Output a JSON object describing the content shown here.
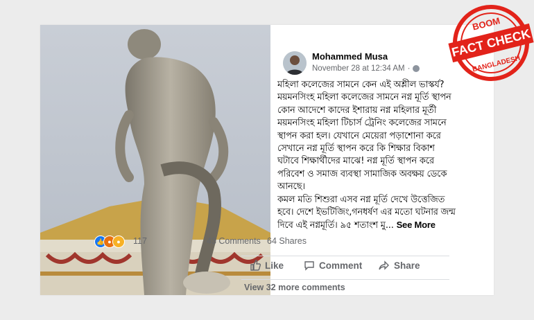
{
  "post": {
    "author": "Mohammed Musa",
    "timestamp": "November 28 at 12:34 AM",
    "separator": "·",
    "lines": [
      "মহিলা কলেজের সামনে কেন এই অশ্লীল ভাস্কর্য?",
      "ময়মনসিংহ মহিলা কলেজের সামনে নগ্ন মূর্তি স্থাপন",
      "কোন আদেশে কাদের ইশারায় নগ্ন মহিলার মূর্তী",
      "ময়মনসিংহ মহিলা টিচার্স ট্রেনিং কলেজের সামনে",
      "স্থাপন করা হল। যেখানে মেয়েরা পড়াশোনা করে",
      "সেখানে নগ্ন মূর্তি স্থাপন করে কি শিক্ষার বিকাশ",
      "ঘটাবে শিক্ষার্থীদের মাঝে! নগ্ন মূর্তি স্থাপন করে",
      "পরিবেশ ও সমাজ ব্যবস্থা সামাজিক অবক্ষয় ডেকে",
      "আনছে।",
      "কমল মতি শিশুরা এসব নগ্ন মূর্তি দেখে উত্তেজিত",
      "হবে। দেশে ইভটিজিং,গনধর্ষণ এর মতো ঘটনার জন্ম",
      "দিবে এই নগ্নমূর্তি। ৯৫ শতাংশ মু..."
    ],
    "see_more": "See More",
    "reaction_count": "117",
    "comments": "43 Comments",
    "shares": "64 Shares",
    "actions": {
      "like": "Like",
      "comment": "Comment",
      "share": "Share"
    },
    "view_more": "View 32 more comments"
  },
  "stamp": {
    "top": "BOOM",
    "main": "FACT CHECK",
    "bottom": "BANGLADESH"
  },
  "icons": [
    "globe-icon",
    "like-reaction-icon",
    "angry-reaction-icon",
    "sad-reaction-icon",
    "thumbs-up-icon",
    "comment-bubble-icon",
    "share-arrow-icon"
  ],
  "colors": {
    "facebook_blue": "#1877f2",
    "stamp_red": "#e2231a",
    "text_gray": "#65676b"
  }
}
